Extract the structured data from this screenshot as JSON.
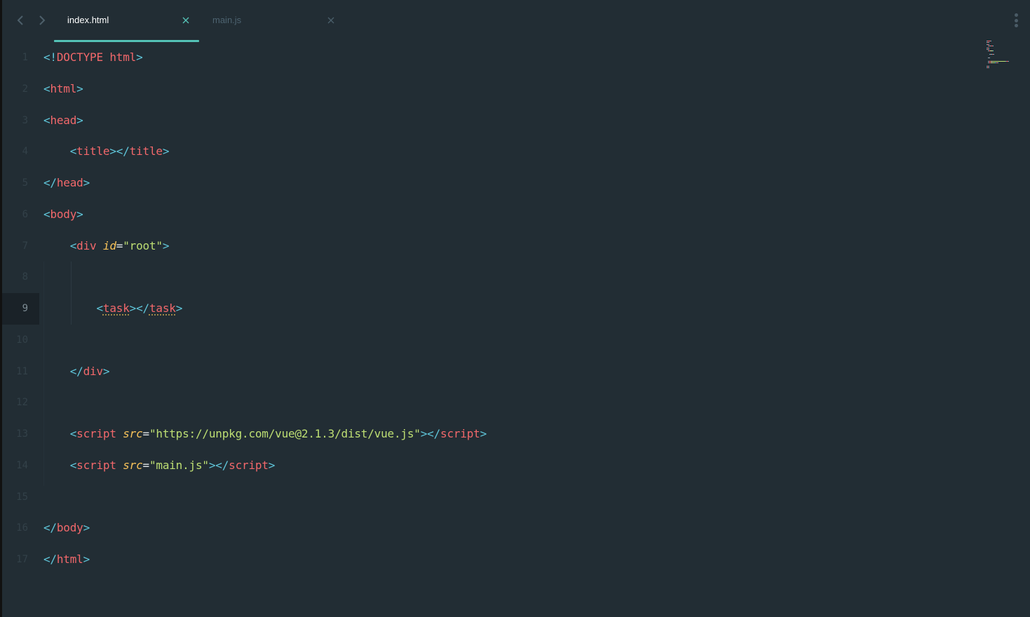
{
  "tabs": [
    {
      "label": "index.html",
      "active": true
    },
    {
      "label": "main.js",
      "active": false
    }
  ],
  "nav": {
    "back_icon": "chevron-left-icon",
    "forward_icon": "chevron-right-icon"
  },
  "colors": {
    "background": "#222d34",
    "accent": "#54c2b6",
    "tag": "#f2686b",
    "punctuation": "#5fc5d9",
    "attribute": "#f8c35a",
    "string": "#bedf73",
    "line_number": "#334149"
  },
  "current_line": 9,
  "lines": [
    {
      "num": "1",
      "tokens": [
        [
          "p",
          "<!"
        ],
        [
          "t",
          "DOCTYPE html"
        ],
        [
          "p",
          ">"
        ]
      ]
    },
    {
      "num": "2",
      "tokens": [
        [
          "p",
          "<"
        ],
        [
          "t",
          "html"
        ],
        [
          "p",
          ">"
        ]
      ]
    },
    {
      "num": "3",
      "tokens": [
        [
          "p",
          "<"
        ],
        [
          "t",
          "head"
        ],
        [
          "p",
          ">"
        ]
      ]
    },
    {
      "num": "4",
      "tokens": [
        [
          "p",
          "    <"
        ],
        [
          "t",
          "title"
        ],
        [
          "p",
          "></"
        ],
        [
          "t",
          "title"
        ],
        [
          "p",
          ">"
        ]
      ]
    },
    {
      "num": "5",
      "tokens": [
        [
          "p",
          "</"
        ],
        [
          "t",
          "head"
        ],
        [
          "p",
          ">"
        ]
      ]
    },
    {
      "num": "6",
      "tokens": [
        [
          "p",
          "<"
        ],
        [
          "t",
          "body"
        ],
        [
          "p",
          ">"
        ]
      ]
    },
    {
      "num": "7",
      "tokens": [
        [
          "p",
          "    <"
        ],
        [
          "t",
          "div "
        ],
        [
          "a",
          "id"
        ],
        [
          "e",
          "="
        ],
        [
          "s",
          "\"root\""
        ],
        [
          "p",
          ">"
        ]
      ]
    },
    {
      "num": "8",
      "tokens": []
    },
    {
      "num": "9",
      "tokens": [
        [
          "p",
          "        <"
        ],
        [
          "tw",
          "task"
        ],
        [
          "p",
          "></"
        ],
        [
          "tw",
          "task"
        ],
        [
          "p",
          ">"
        ]
      ]
    },
    {
      "num": "10",
      "tokens": []
    },
    {
      "num": "11",
      "tokens": [
        [
          "p",
          "    </"
        ],
        [
          "t",
          "div"
        ],
        [
          "p",
          ">"
        ]
      ]
    },
    {
      "num": "12",
      "tokens": []
    },
    {
      "num": "13",
      "tokens": [
        [
          "p",
          "    <"
        ],
        [
          "t",
          "script "
        ],
        [
          "a",
          "src"
        ],
        [
          "e",
          "="
        ],
        [
          "s",
          "\"https://unpkg.com/vue@2.1.3/dist/vue.js\""
        ],
        [
          "p",
          "></"
        ],
        [
          "t",
          "script"
        ],
        [
          "p",
          ">"
        ]
      ]
    },
    {
      "num": "14",
      "tokens": [
        [
          "p",
          "    <"
        ],
        [
          "t",
          "script "
        ],
        [
          "a",
          "src"
        ],
        [
          "e",
          "="
        ],
        [
          "s",
          "\"main.js\""
        ],
        [
          "p",
          "></"
        ],
        [
          "t",
          "script"
        ],
        [
          "p",
          ">"
        ]
      ]
    },
    {
      "num": "15",
      "tokens": []
    },
    {
      "num": "16",
      "tokens": [
        [
          "p",
          "</"
        ],
        [
          "t",
          "body"
        ],
        [
          "p",
          ">"
        ]
      ]
    },
    {
      "num": "17",
      "tokens": [
        [
          "p",
          "</"
        ],
        [
          "t",
          "html"
        ],
        [
          "p",
          ">"
        ]
      ]
    }
  ]
}
